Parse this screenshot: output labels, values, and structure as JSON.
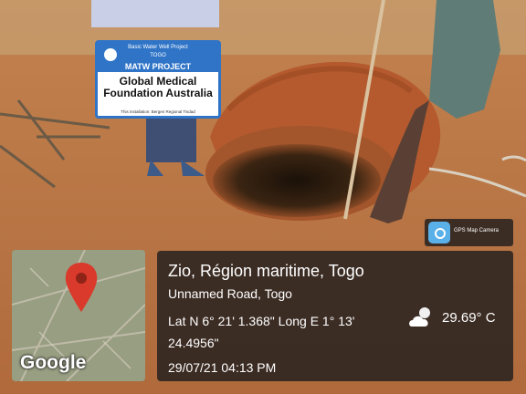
{
  "sign": {
    "header_line1": "Basic Water Well Project",
    "header_line2": "TOGO",
    "project": "MATW PROJECT",
    "org_line1": "Global Medical",
    "org_line2": "Foundation Australia",
    "footer": "This installation: Bergen Regional Tisdad"
  },
  "geo_tag": {
    "location": "Zio, Région maritime, Togo",
    "road": "Unnamed Road, Togo",
    "coordinates_line1": "Lat N 6° 21' 1.368\" Long E 1° 13'",
    "coordinates_line2": "24.4956\"",
    "datetime": "29/07/21 04:13 PM",
    "temperature": "29.69° C",
    "weather_icon": "partly-cloudy-icon"
  },
  "app_badge": {
    "label": "GPS Map Camera",
    "icon": "camera-app-icon"
  },
  "map_thumb": {
    "brand": "Google",
    "pin_icon": "map-pin-icon",
    "pin_color": "#d93a2b"
  }
}
